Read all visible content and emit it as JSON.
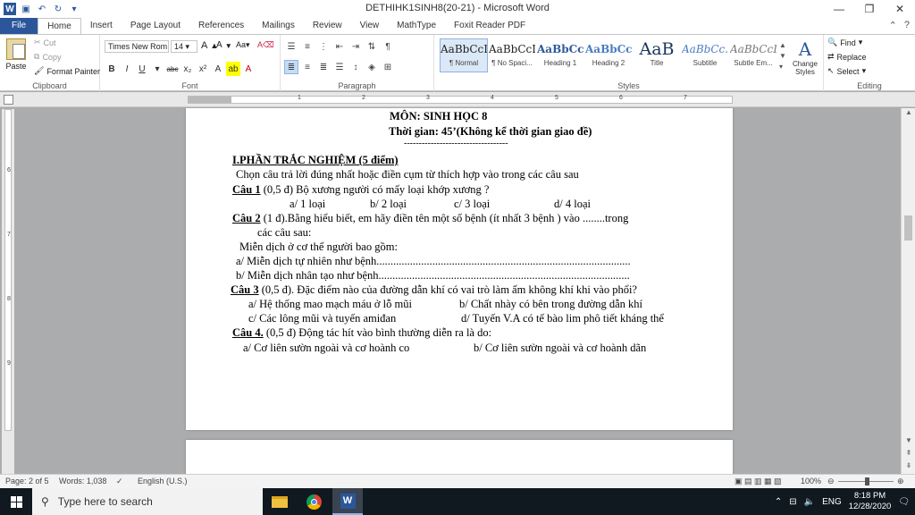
{
  "window": {
    "title": "DETHIHK1SINH8(20-21) - Microsoft Word",
    "controls": [
      "—",
      "❐",
      "✕"
    ]
  },
  "tabs": [
    "File",
    "Home",
    "Insert",
    "Page Layout",
    "References",
    "Mailings",
    "Review",
    "View",
    "MathType",
    "Foxit Reader PDF"
  ],
  "ribbon": {
    "clipboard": {
      "paste": "Paste",
      "cut": "Cut",
      "copy": "Copy",
      "format_painter": "Format Painter",
      "label": "Clipboard"
    },
    "font": {
      "name": "Times New Rom",
      "size": "14",
      "label": "Font"
    },
    "paragraph": {
      "label": "Paragraph"
    },
    "styles": {
      "label": "Styles",
      "items": [
        {
          "preview": "AaBbCcI",
          "name": "¶ Normal"
        },
        {
          "preview": "AaBbCcI",
          "name": "¶ No Spaci..."
        },
        {
          "preview": "AaBbCc",
          "name": "Heading 1"
        },
        {
          "preview": "AaBbCc",
          "name": "Heading 2"
        },
        {
          "preview": "AaB",
          "name": "Title"
        },
        {
          "preview": "AaBbCc.",
          "name": "Subtitle"
        },
        {
          "preview": "AaBbCcD",
          "name": "Subtle Em..."
        }
      ],
      "change_styles": "Change Styles"
    },
    "editing": {
      "find": "Find",
      "replace": "Replace",
      "select": "Select",
      "label": "Editing"
    }
  },
  "ruler": {
    "numbers": [
      "1",
      "2",
      "3",
      "4",
      "5",
      "6",
      "7"
    ],
    "vnumbers": [
      "6",
      "7",
      "8",
      "9"
    ]
  },
  "document": {
    "lines": [
      "MÔN: SINH HỌC 8",
      "Thời gian: 45’(Không kể thời gian giao đề)",
      "-----------------------------------",
      "I.PHẦN TRẮC NGHIỆM (5 điểm)",
      "Chọn câu trả lời đúng nhất hoặc điền cụm từ thích hợp vào trong các câu sau",
      "Câu 1",
      "(0,5 đ) Bộ xương người có mấy loại khớp xương ?",
      "a/ 1 loại",
      "b/ 2 loại",
      "c/ 3 loại",
      "d/ 4 loại",
      "Câu 2",
      "(1 đ).Bằng hiểu biết, em hãy điền tên một số bệnh (ít nhất 3 bệnh ) vào ........trong",
      "các câu sau:",
      "Miễn dịch ở cơ thể người bao gồm:",
      "a/ Miễn dịch tự nhiên như bệnh...........................................................................................",
      "b/ Miễn dịch nhân tạo như bệnh..........................................................................................",
      "Câu 3",
      "(0,5 đ). Đặc điểm nào của đường dẫn khí có vai trò làm ấm không khí khi vào phổi?",
      "a/ Hệ thống mao mạch máu ở lỗ mũi",
      "b/ Chất nhày có bên trong đường dẫn khí",
      "c/ Các lông mũi và tuyến amiđan",
      "d/ Tuyến V.A có tế bào lim phô tiết kháng thể",
      "Câu 4.",
      "(0,5 đ)  Động tác hít vào bình thường diễn ra là do:",
      "a/ Cơ liên sườn ngoài và cơ hoành co",
      "b/ Cơ liên sườn ngoài và cơ hoành dãn"
    ]
  },
  "status": {
    "page": "Page: 2 of 5",
    "words": "Words: 1,038",
    "language": "English (U.S.)",
    "zoom": "100%"
  },
  "taskbar": {
    "search_placeholder": "Type here to search",
    "lang": "ENG",
    "time": "8:18 PM",
    "date": "12/28/2020"
  }
}
